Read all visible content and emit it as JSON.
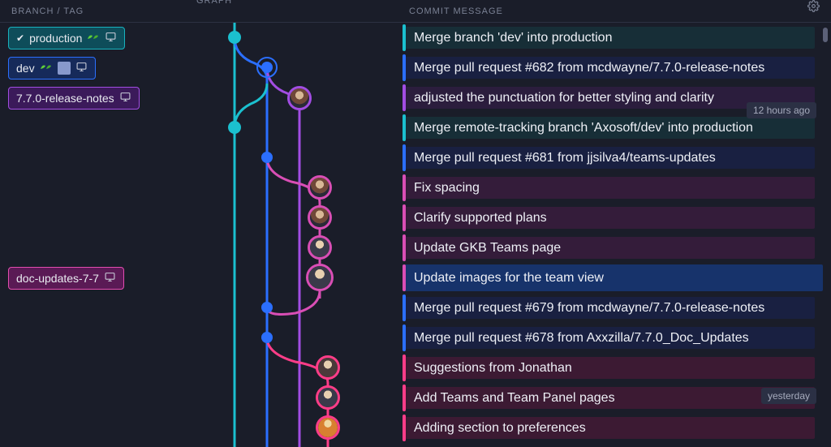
{
  "headers": {
    "branch": "BRANCH / TAG",
    "graph": "GRAPH",
    "message": "COMMIT MESSAGE"
  },
  "timestamps": {
    "row2": "12 hours ago",
    "row12": "yesterday"
  },
  "branches": {
    "production": "production",
    "dev": "dev",
    "release_notes": "7.7.0-release-notes",
    "doc_updates": "doc-updates-7-7"
  },
  "commits": [
    {
      "msg": "Merge branch 'dev' into production",
      "bar": "#153c44",
      "div": "#1bc0cf"
    },
    {
      "msg": "Merge pull request #682 from mcdwayne/7.7.0-release-notes",
      "bar": "#1a2356",
      "div": "#2b6fff"
    },
    {
      "msg": "adjusted the punctuation for better styling and clarity",
      "bar": "#3a1d4e",
      "div": "#a24de3"
    },
    {
      "msg": "Merge remote-tracking branch 'Axosoft/dev' into production",
      "bar": "#153c44",
      "div": "#1bc0cf"
    },
    {
      "msg": "Merge pull request #681 from jjsilva4/teams-updates",
      "bar": "#1a2356",
      "div": "#2b6fff"
    },
    {
      "msg": "Fix spacing",
      "bar": "#4b1c49",
      "div": "#d94eb5"
    },
    {
      "msg": "Clarify supported plans",
      "bar": "#4b1c49",
      "div": "#d94eb5"
    },
    {
      "msg": "Update GKB Teams page",
      "bar": "#4b1c49",
      "div": "#d94eb5"
    },
    {
      "msg": "Update images for the team view",
      "bar": "#4b1c49",
      "div": "#d94eb5",
      "selected": true
    },
    {
      "msg": "Merge pull request #679 from mcdwayne/7.7.0-release-notes",
      "bar": "#1a2356",
      "div": "#2b6fff"
    },
    {
      "msg": "Merge pull request #678 from Axxzilla/7.7.0_Doc_Updates",
      "bar": "#1a2356",
      "div": "#2b6fff"
    },
    {
      "msg": "Suggestions from Jonathan",
      "bar": "#5a183c",
      "div": "#ff3d88"
    },
    {
      "msg": "Add Teams and Team Panel pages",
      "bar": "#5a183c",
      "div": "#ff3d88"
    },
    {
      "msg": "Adding section to preferences",
      "bar": "#5a183c",
      "div": "#ff3d88"
    }
  ],
  "colors": {
    "teal": "#1bc0cf",
    "blue": "#2b6fff",
    "purple": "#a24de3",
    "pink": "#d94eb5",
    "hotpink": "#ff3d88"
  }
}
